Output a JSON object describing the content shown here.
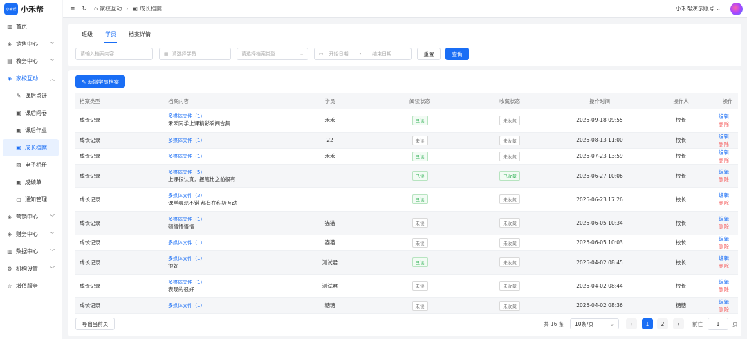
{
  "app": {
    "name": "小禾帮",
    "logo_text": "小禾帮"
  },
  "sidebar": {
    "items": [
      {
        "label": "首页",
        "icon": "chart-icon"
      },
      {
        "label": "销售中心",
        "icon": "cube-icon"
      },
      {
        "label": "教务中心",
        "icon": "book-icon"
      },
      {
        "label": "家校互动",
        "icon": "cube-icon"
      },
      {
        "label": "课后点评",
        "icon": "edit-icon"
      },
      {
        "label": "课后问卷",
        "icon": "doc-icon"
      },
      {
        "label": "课后作业",
        "icon": "doc-icon"
      },
      {
        "label": "成长档案",
        "icon": "doc-icon"
      },
      {
        "label": "电子相册",
        "icon": "image-icon"
      },
      {
        "label": "成绩单",
        "icon": "doc-icon"
      },
      {
        "label": "通知管理",
        "icon": "message-icon"
      },
      {
        "label": "营销中心",
        "icon": "cube-icon"
      },
      {
        "label": "财务中心",
        "icon": "cube-icon"
      },
      {
        "label": "数据中心",
        "icon": "chart-icon"
      },
      {
        "label": "机构设置",
        "icon": "gear-icon"
      },
      {
        "label": "增值服务",
        "icon": "star-icon"
      }
    ]
  },
  "topbar": {
    "breadcrumb": [
      "家校互动",
      "成长档案"
    ],
    "account": "小禾帮演示账号"
  },
  "tabs": [
    "班级",
    "学员",
    "档案详情"
  ],
  "filters": {
    "content_placeholder": "请输入档案内容",
    "student_placeholder": "请选择学员",
    "type_placeholder": "请选择档案类型",
    "start_placeholder": "开始日期",
    "date_sep": "-",
    "end_placeholder": "结束日期",
    "reset": "重置",
    "search": "查询"
  },
  "add_button": "✎ 新增学员档案",
  "table": {
    "headers": [
      "档案类型",
      "档案内容",
      "学员",
      "阅读状态",
      "收藏状态",
      "操作时间",
      "操作人",
      "操作"
    ],
    "rows": [
      {
        "type": "成长记录",
        "media": "多媒体文件（1）",
        "text": "禾禾同学上课精彩瞬间合集",
        "student": "禾禾",
        "read": "已读",
        "fav": "未收藏",
        "time": "2025-09-18 09:55",
        "op": "校长"
      },
      {
        "type": "成长记录",
        "media": "多媒体文件（1）",
        "text": "",
        "student": "22",
        "read": "未读",
        "fav": "未收藏",
        "time": "2025-08-13 11:00",
        "op": "校长"
      },
      {
        "type": "成长记录",
        "media": "多媒体文件（1）",
        "text": "",
        "student": "禾禾",
        "read": "已读",
        "fav": "未收藏",
        "time": "2025-07-23 13:59",
        "op": "校长"
      },
      {
        "type": "成长记录",
        "media": "多媒体文件（5）",
        "text": "上课很认真，握笔比之前很有...",
        "student": "",
        "read": "已读",
        "fav": "已收藏",
        "time": "2025-06-27 10:06",
        "op": "校长"
      },
      {
        "type": "成长记录",
        "media": "多媒体文件（3）",
        "text": "课堂表现不错 都有在积极互动",
        "student": "",
        "read": "已读",
        "fav": "未收藏",
        "time": "2025-06-23 17:26",
        "op": "校长"
      },
      {
        "type": "成长记录",
        "media": "多媒体文件（1）",
        "text": "顿悟悟悟悟",
        "student": "猫猫",
        "read": "未读",
        "fav": "未收藏",
        "time": "2025-06-05 10:34",
        "op": "校长"
      },
      {
        "type": "成长记录",
        "media": "多媒体文件（1）",
        "text": "",
        "student": "猫猫",
        "read": "未读",
        "fav": "未收藏",
        "time": "2025-06-05 10:03",
        "op": "校长"
      },
      {
        "type": "成长记录",
        "media": "多媒体文件（1）",
        "text": "很好",
        "student": "测试君",
        "read": "已读",
        "fav": "未收藏",
        "time": "2025-04-02 08:45",
        "op": "校长"
      },
      {
        "type": "成长记录",
        "media": "多媒体文件（1）",
        "text": "表现的很好",
        "student": "测试君",
        "read": "未读",
        "fav": "未收藏",
        "time": "2025-04-02 08:44",
        "op": "校长"
      },
      {
        "type": "成长记录",
        "media": "多媒体文件（1）",
        "text": "",
        "student": "糖糖",
        "read": "未读",
        "fav": "未收藏",
        "time": "2025-04-02 08:36",
        "op": "糖糖"
      }
    ],
    "edit": "编辑",
    "delete": "删除"
  },
  "footer": {
    "export": "导出当前页",
    "total": "共 16 条",
    "page_size": "10条/页",
    "pages": [
      "1",
      "2"
    ],
    "goto_label": "前往",
    "goto_value": "1",
    "goto_unit": "页"
  }
}
